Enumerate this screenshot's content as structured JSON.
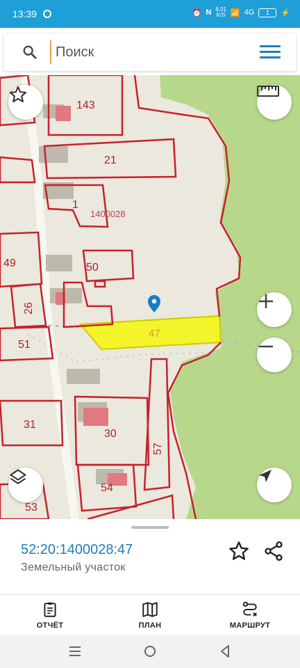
{
  "status_bar": {
    "time": "13:39",
    "net_speed_top": "8,01",
    "net_speed_bottom": "K/S",
    "signal": "4G",
    "battery": "1"
  },
  "search": {
    "placeholder": "Поиск",
    "value": ""
  },
  "map": {
    "plot_labels": [
      "143",
      "21",
      "1",
      "1400028",
      "49",
      "50",
      "26",
      "51",
      "47",
      "31",
      "30",
      "57",
      "54",
      "53"
    ],
    "selected_plot": "47",
    "colors": {
      "boundary": "#c8202b",
      "selected_fill": "#f4f42a",
      "forest": "#b7d88b",
      "ground": "#ebe8dd",
      "pin": "#1a7cc2"
    }
  },
  "controls": {
    "favorite": "star-icon",
    "ruler": "ruler-icon",
    "zoom_in": "plus-icon",
    "zoom_out": "minus-icon",
    "layers": "layers-icon",
    "locate": "navigation-arrow-icon"
  },
  "info": {
    "cadastral_number": "52:20:1400028:47",
    "object_type": "Земельный участок"
  },
  "bottom_nav": {
    "items": [
      {
        "label": "ОТЧЁТ",
        "icon": "clipboard-icon"
      },
      {
        "label": "ПЛАН",
        "icon": "map-icon"
      },
      {
        "label": "МАРШРУТ",
        "icon": "route-icon"
      }
    ]
  },
  "system_nav": {
    "buttons": [
      "menu",
      "home",
      "back"
    ]
  }
}
